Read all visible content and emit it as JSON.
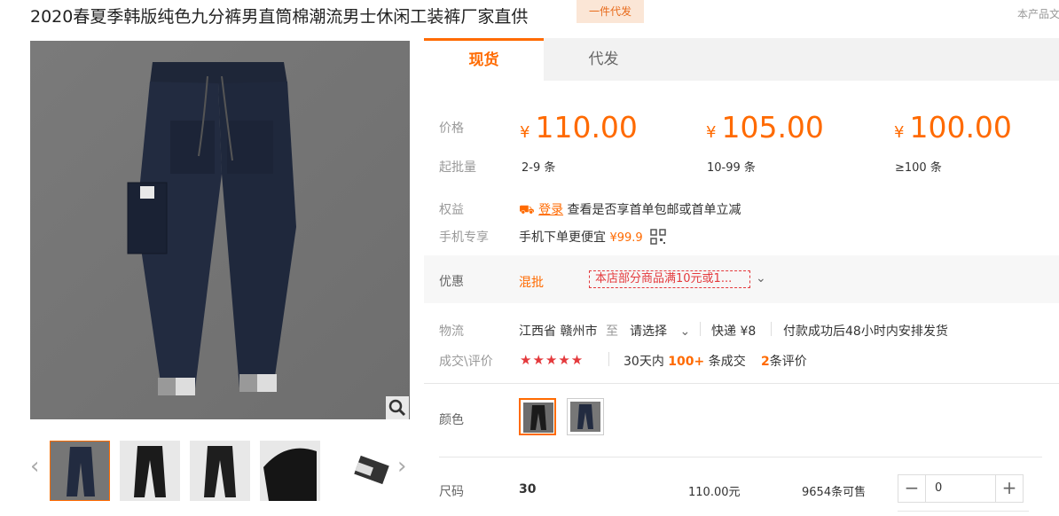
{
  "product": {
    "title": "2020春夏季韩版纯色九分裤男直筒棉潮流男士休闲工装裤厂家直供",
    "badge": "一件代发",
    "top_right": "本产品文"
  },
  "tabs": [
    {
      "label": "现货",
      "active": true
    },
    {
      "label": "代发",
      "active": false
    }
  ],
  "pricing": {
    "price_label": "价格",
    "min_qty_label": "起批量",
    "currency": "¥",
    "tiers": [
      {
        "price": "110.00",
        "qty": "2-9 条"
      },
      {
        "price": "105.00",
        "qty": "10-99 条"
      },
      {
        "price": "100.00",
        "qty": "≥100 条"
      }
    ]
  },
  "benefits": {
    "label": "权益",
    "login_link": "登录",
    "text": "查看是否享首单包邮或首单立减"
  },
  "mobile": {
    "label": "手机专享",
    "text": "手机下单更便宜",
    "price": "¥99.9"
  },
  "promo": {
    "label": "优惠",
    "type": "混批",
    "coupon": "本店部分商品满10元或1..."
  },
  "logistics": {
    "label": "物流",
    "origin": "江西省 赣州市",
    "to": "至",
    "destination": "请选择",
    "shipping": "快递 ¥8",
    "dispatch": "付款成功后48小时内安排发货"
  },
  "deals": {
    "label": "成交\\评价",
    "stars": "★★★★★",
    "rating": 5,
    "sales_prefix": "30天内",
    "sales_count": "100+",
    "sales_suffix": "条成交",
    "review_count": "2",
    "review_suffix": "条评价"
  },
  "color": {
    "label": "颜色"
  },
  "size": {
    "label": "尺码",
    "value": "30",
    "price": "110.00元",
    "stock": "9654条可售",
    "quantity": "0",
    "minus": "−",
    "plus": "+"
  },
  "colors": {
    "accent": "#ff6a00",
    "red": "#e4393c"
  }
}
